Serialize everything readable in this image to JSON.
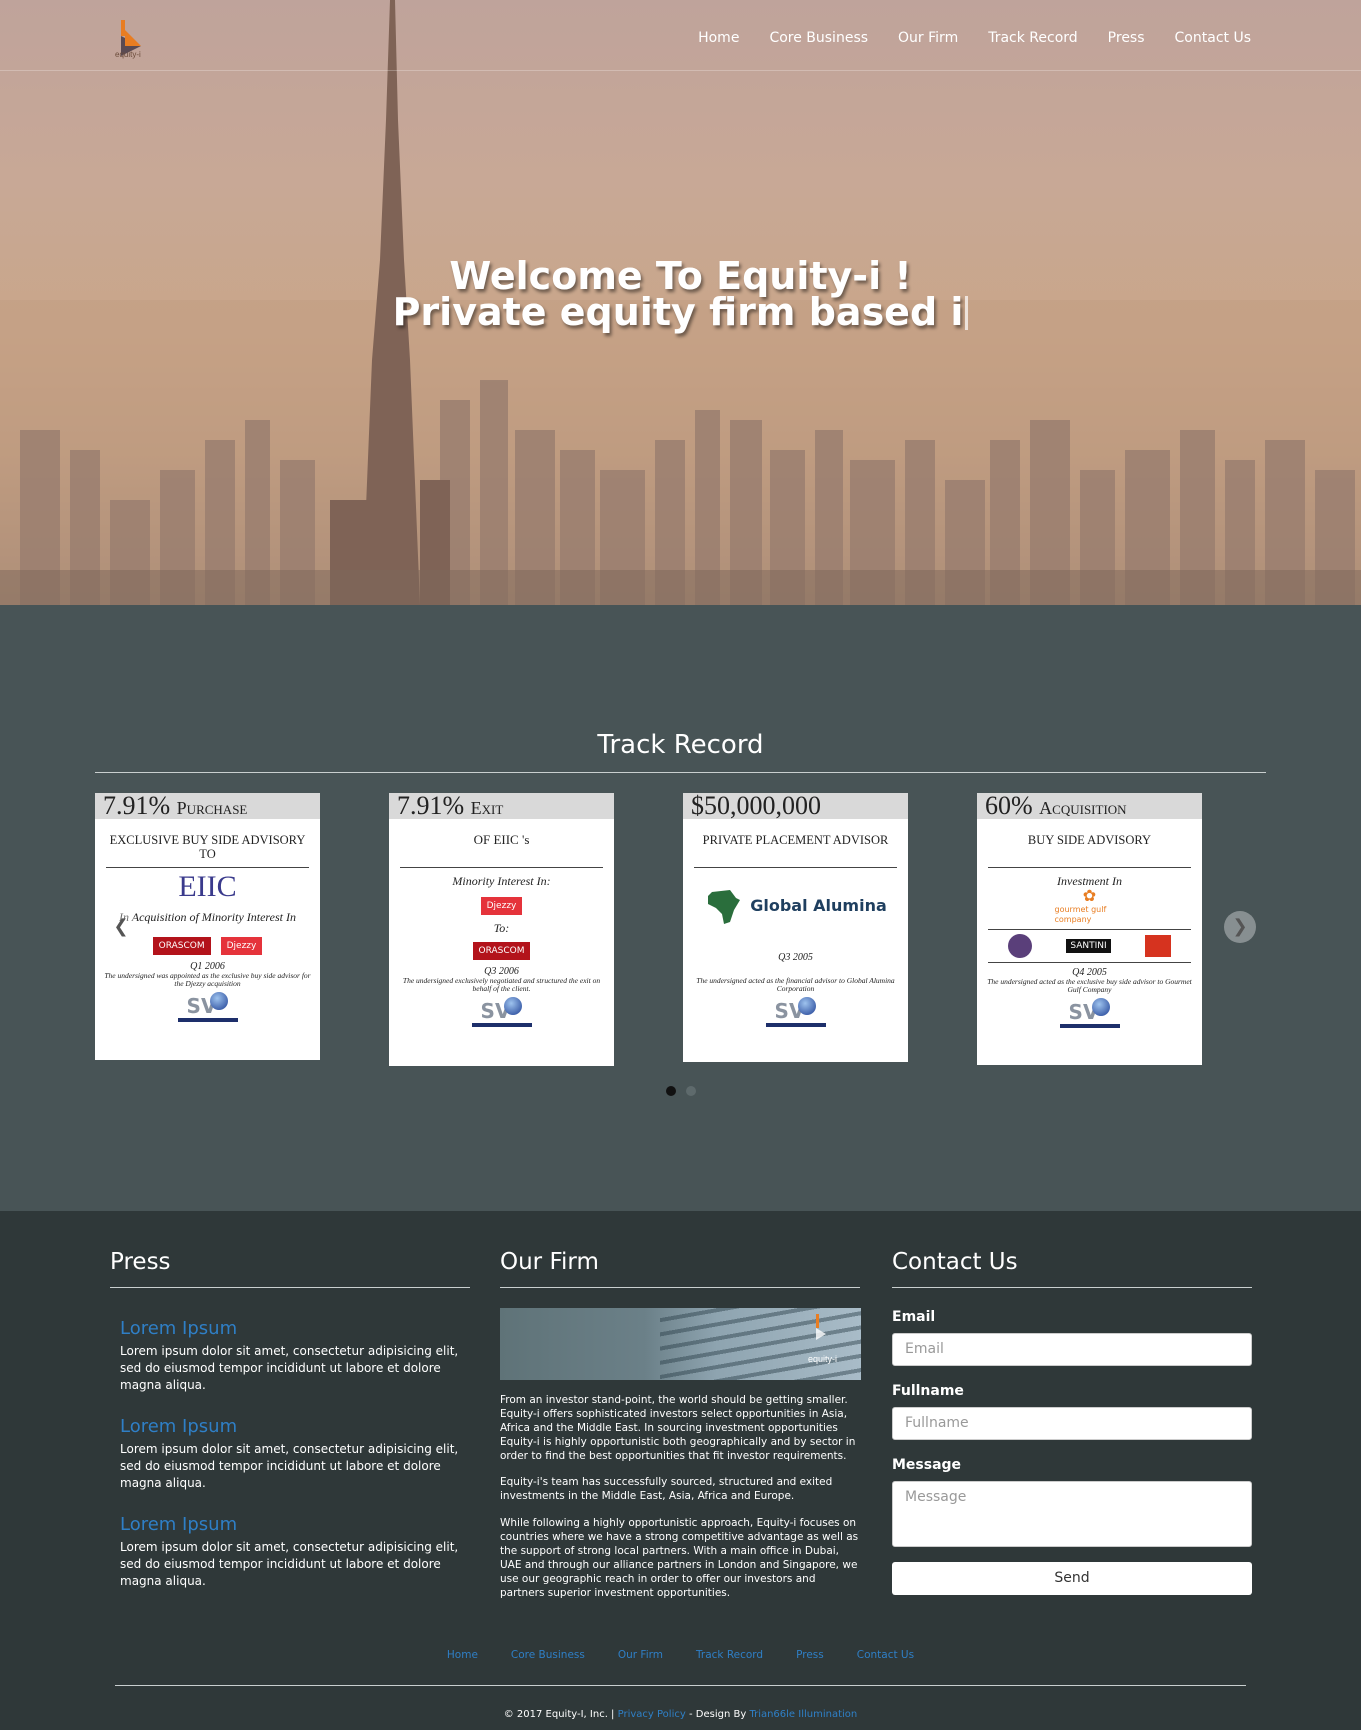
{
  "brand": {
    "logo_text": "equity-i"
  },
  "nav": [
    "Home",
    "Core Business",
    "Our Firm",
    "Track Record",
    "Press",
    "Contact Us"
  ],
  "hero": {
    "line1": "Welcome To Equity-i !",
    "line2": "Private equity firm based i"
  },
  "track": {
    "title": "Track Record",
    "cards": [
      {
        "head_big": "7.91%",
        "head_small": "Purchase",
        "sub": "EXCLUSIVE BUY SIDE ADVISORY TO",
        "italic1": "In Acquisition of Minority Interest In",
        "date": "Q1 2006",
        "note": "The undersigned was appointed as the exclusive buy side advisor for the Djezzy acquisition"
      },
      {
        "head_big": "7.91%",
        "head_small": "Exit",
        "sub": "OF EIIC 's",
        "italic1": "Minority Interest In:",
        "italic2": "To:",
        "date": "Q3 2006",
        "note": "The undersigned exclusively negotiated and structured the exit on behalf of the client."
      },
      {
        "head_big": "$50,000,000",
        "head_small": "",
        "sub": "PRIVATE PLACEMENT ADVISOR",
        "logo": "Global Alumina",
        "date": "Q3 2005",
        "note": "The undersigned acted as the financial advisor to Global Alumina Corporation"
      },
      {
        "head_big": "60%",
        "head_small": "Acquisition",
        "sub": "BUY SIDE ADVISORY",
        "italic1": "Investment In",
        "logo": "gourmet gulf company",
        "date": "Q4 2005",
        "note": "The undersigned acted as the exclusive buy side advisor to Gourmet Gulf Company"
      }
    ],
    "card_logos": {
      "eiic": "EIIC",
      "orascom": "ORASCOM",
      "djezzy": "Djezzy",
      "sv": "SV",
      "source": "Source Capital",
      "santini": "SANTINI"
    }
  },
  "press": {
    "title": "Press",
    "items": [
      {
        "title": "Lorem Ipsum",
        "body": "Lorem ipsum dolor sit amet, consectetur adipisicing elit, sed do eiusmod tempor incididunt ut labore et dolore magna aliqua."
      },
      {
        "title": "Lorem Ipsum",
        "body": "Lorem ipsum dolor sit amet, consectetur adipisicing elit, sed do eiusmod tempor incididunt ut labore et dolore magna aliqua."
      },
      {
        "title": "Lorem Ipsum",
        "body": "Lorem ipsum dolor sit amet, consectetur adipisicing elit, sed do eiusmod tempor incididunt ut labore et dolore magna aliqua."
      }
    ]
  },
  "firm": {
    "title": "Our Firm",
    "image_text": "equity-i",
    "paragraphs": [
      "From an investor stand-point, the world should be getting smaller. Equity-i offers sophisticated investors select opportunities in Asia, Africa and the Middle East. In sourcing investment opportunities Equity-i is highly opportunistic both geographically and by sector in order to find the best opportunities that fit investor requirements.",
      "Equity-i's team has successfully sourced, structured and exited investments in the Middle East, Asia, Africa and Europe.",
      "While following a highly opportunistic approach, Equity-i focuses on countries where we have a strong competitive advantage as well as the support of strong local partners. With a main office in Dubai, UAE and through our alliance partners in London and Singapore, we use our geographic reach in order to offer our investors and partners superior investment opportunities."
    ]
  },
  "contact": {
    "title": "Contact Us",
    "email_label": "Email",
    "email_placeholder": "Email",
    "name_label": "Fullname",
    "name_placeholder": "Fullname",
    "message_label": "Message",
    "message_placeholder": "Message",
    "send": "Send"
  },
  "footer": {
    "nav": [
      "Home",
      "Core Business",
      "Our Firm",
      "Track Record",
      "Press",
      "Contact Us"
    ],
    "copyright": "© 2017 Equity-I, Inc. |",
    "privacy": "Privacy Policy",
    "design_by": "- Design By",
    "designer": "Trian66le Illumination"
  },
  "colors": {
    "accent": "#2f7fc6",
    "track_bg": "#485456",
    "footer_bg": "#2f3839"
  }
}
